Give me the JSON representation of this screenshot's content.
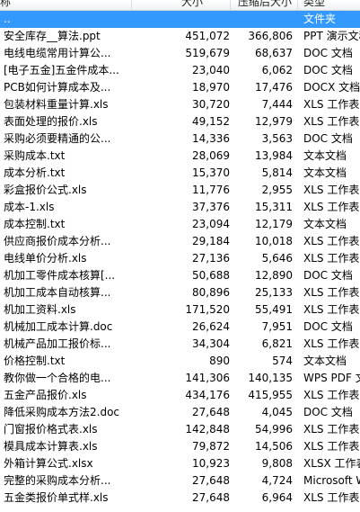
{
  "header": {
    "name": "称",
    "size": "大小",
    "compressed": "压缩后大小",
    "type": "类型"
  },
  "rows": [
    {
      "name": "..",
      "size": "",
      "compressed": "",
      "type": "文件夹",
      "selected": true
    },
    {
      "name": "安全库存__算法.ppt",
      "size": "451,072",
      "compressed": "366,806",
      "type": "PPT 演示文稿"
    },
    {
      "name": "电线电缆常用计算公...",
      "size": "519,679",
      "compressed": "68,637",
      "type": "DOC 文档"
    },
    {
      "name": "[电子五金]五金件成本...",
      "size": "23,040",
      "compressed": "6,062",
      "type": "DOC 文档"
    },
    {
      "name": "PCB如何计算成本及...",
      "size": "18,970",
      "compressed": "17,476",
      "type": "DOCX 文档"
    },
    {
      "name": "包装材料重量计算.xls",
      "size": "30,720",
      "compressed": "7,444",
      "type": "XLS 工作表"
    },
    {
      "name": "表面处理的报价.xls",
      "size": "49,152",
      "compressed": "12,979",
      "type": "XLS 工作表"
    },
    {
      "name": "采购必须要精通的公...",
      "size": "14,336",
      "compressed": "3,563",
      "type": "DOC 文档"
    },
    {
      "name": "采购成本.txt",
      "size": "28,069",
      "compressed": "13,984",
      "type": "文本文档"
    },
    {
      "name": "成本分析.txt",
      "size": "15,370",
      "compressed": "5,814",
      "type": "文本文档"
    },
    {
      "name": "彩盒报价公式.xls",
      "size": "11,776",
      "compressed": "2,955",
      "type": "XLS 工作表"
    },
    {
      "name": "成本-1.xls",
      "size": "37,376",
      "compressed": "15,311",
      "type": "XLS 工作表"
    },
    {
      "name": "成本控制.txt",
      "size": "23,094",
      "compressed": "12,179",
      "type": "文本文档"
    },
    {
      "name": "供应商报价成本分析...",
      "size": "29,184",
      "compressed": "10,018",
      "type": "XLS 工作表"
    },
    {
      "name": "电线单价分析.xls",
      "size": "27,136",
      "compressed": "5,646",
      "type": "XLS 工作表"
    },
    {
      "name": "机加工零件成本核算[...",
      "size": "50,688",
      "compressed": "12,890",
      "type": "DOC 文档"
    },
    {
      "name": "机加工成本自动核算...",
      "size": "80,896",
      "compressed": "25,133",
      "type": "XLS 工作表"
    },
    {
      "name": "机加工资料.xls",
      "size": "171,520",
      "compressed": "55,491",
      "type": "XLS 工作表"
    },
    {
      "name": "机械加工成本计算.doc",
      "size": "26,624",
      "compressed": "7,951",
      "type": "DOC 文档"
    },
    {
      "name": "机械产品加工报价标...",
      "size": "34,304",
      "compressed": "6,821",
      "type": "XLS 工作表"
    },
    {
      "name": "价格控制.txt",
      "size": "890",
      "compressed": "574",
      "type": "文本文档"
    },
    {
      "name": "教你做一个合格的电...",
      "size": "141,306",
      "compressed": "140,135",
      "type": "WPS PDF 文档"
    },
    {
      "name": "五金产品报价.xls",
      "size": "434,176",
      "compressed": "415,955",
      "type": "XLS 工作表"
    },
    {
      "name": "降低采购成本方法2.doc",
      "size": "27,648",
      "compressed": "4,045",
      "type": "DOC 文档"
    },
    {
      "name": "门窗报价格式表.xls",
      "size": "142,848",
      "compressed": "54,996",
      "type": "XLS 工作表"
    },
    {
      "name": "模具成本计算表.xls",
      "size": "79,872",
      "compressed": "14,506",
      "type": "XLS 工作表"
    },
    {
      "name": "外箱计算公式.xlsx",
      "size": "10,923",
      "compressed": "9,808",
      "type": "XLSX 工作表"
    },
    {
      "name": "完整的采购成本分析...",
      "size": "27,648",
      "compressed": "4,724",
      "type": "Microsoft W"
    },
    {
      "name": "五金类报价单式样.xls",
      "size": "27,648",
      "compressed": "6,964",
      "type": "XLS 工作表"
    }
  ]
}
